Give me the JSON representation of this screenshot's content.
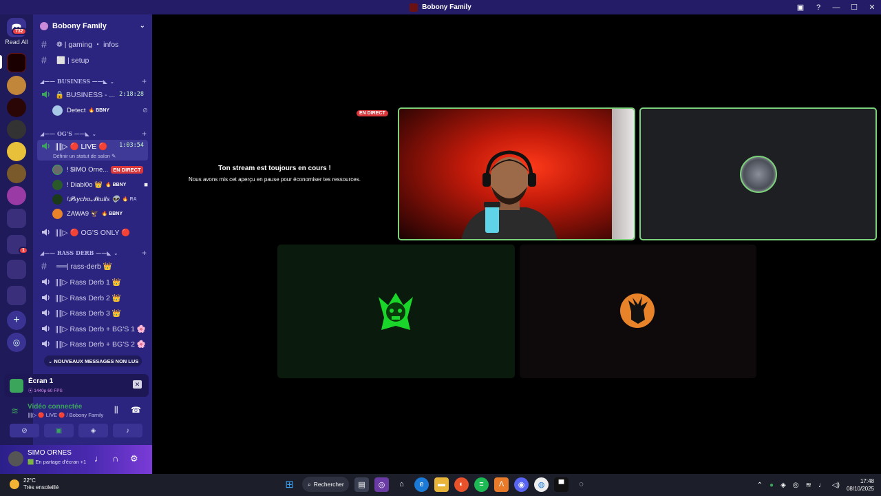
{
  "window": {
    "title": "Bobony Family"
  },
  "guilds": {
    "dm_badge": "732",
    "read_all": "Read All",
    "badge_1": "1"
  },
  "server": {
    "name": "Bobony Family"
  },
  "channels": {
    "gaming": "❁ | gaming ・ infos",
    "setup": "⬜ | setup",
    "cat_business": "◢—— BUSINESS ——◣",
    "business_channel": "🔒 BUSINESS - ...",
    "business_timer": "2:18:28",
    "detect_user": "Detect",
    "detect_tag": "🔥 BBNY",
    "cat_ogs": "◢—— OG'S ——◣",
    "live_channel": "∥∥▷ 🔴 LIVE 🔴",
    "live_timer": "1:03:54",
    "status_hint": "Définir un statut de salon ✎",
    "user1": "! $IMO Orne...",
    "user1_tag": "EN DIRECT",
    "user2": "! Diabl0o 👑",
    "user2_tag": "🔥 BBNY",
    "user3": "!𝓟sycho𝓝kulls 👽",
    "user3_tag": "🔥 RA",
    "user4": "ZAWA9 🦅",
    "user4_tag": "🔥 BBNY",
    "ogs_only": "∥∥▷ 🔴 OG'S ONLY 🔴",
    "cat_rass": "◢—— RASS DERB ——◣",
    "rass_derb": "══| rass-derb 👑",
    "rd1": "∥∥▷ Rass Derb 1 👑",
    "rd2": "∥∥▷ Rass Derb 2 👑",
    "rd3": "∥∥▷ Rass Derb 3 👑",
    "rdbg1": "∥∥▷ Rass Derb + BG'S 1 🌸",
    "rdbg2": "∥∥▷ Rass Derb + BG'S 2 🌸",
    "new_messages": "⌄ NOUVEAUX MESSAGES NON LUS"
  },
  "screen": {
    "title": "Écran 1",
    "quality": "⦿ 1440p 60 FPS"
  },
  "voice": {
    "status": "Vidéo connectée",
    "location": "∥∥▷ 🔴 LIVE 🔴 / Bobony Family"
  },
  "user": {
    "name": "SIMO ORNES",
    "status": "🟩 En partage d'écran +1"
  },
  "stage": {
    "paused_title": "Ton stream est toujours en cours !",
    "paused_sub": "Nous avons mis cet aperçu en pause pour économiser tes ressources.",
    "direct_tag": "EN DIRECT"
  },
  "taskbar": {
    "temp": "22°C",
    "weather": "Très ensoleillé",
    "search": "Rechercher",
    "time": "17:48",
    "date": "08/10/2025"
  },
  "colors": {
    "accent": "#2b2580",
    "live": "#da373c",
    "online": "#3ba55c"
  }
}
